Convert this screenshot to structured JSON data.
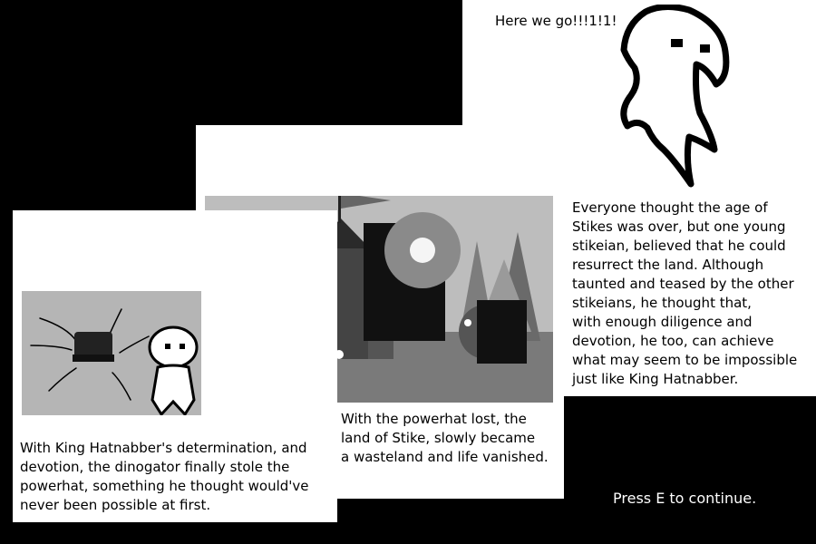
{
  "dialogue": {
    "text": "Here we go!!!1!1!"
  },
  "panel_left": {
    "caption": "With King Hatnabber's determination, and\ndevotion, the dinogator finally stole the\npowerhat, something he thought would've\nnever been possible at first."
  },
  "panel_middle": {
    "caption": "With the powerhat lost, the\nland of Stike, slowly became\na wasteland and life vanished."
  },
  "panel_right": {
    "caption": "Everyone thought the age of\nStikes was over, but one young\nstikeian, believed that he could\nresurrect the land. Although\ntaunted and teased by the other\nstikeians, he thought that,\nwith enough diligence and\ndevotion, he too, can achieve\nwhat may seem to be impossible\njust like King Hatnabber."
  },
  "prompt": {
    "text": "Press E to continue."
  }
}
